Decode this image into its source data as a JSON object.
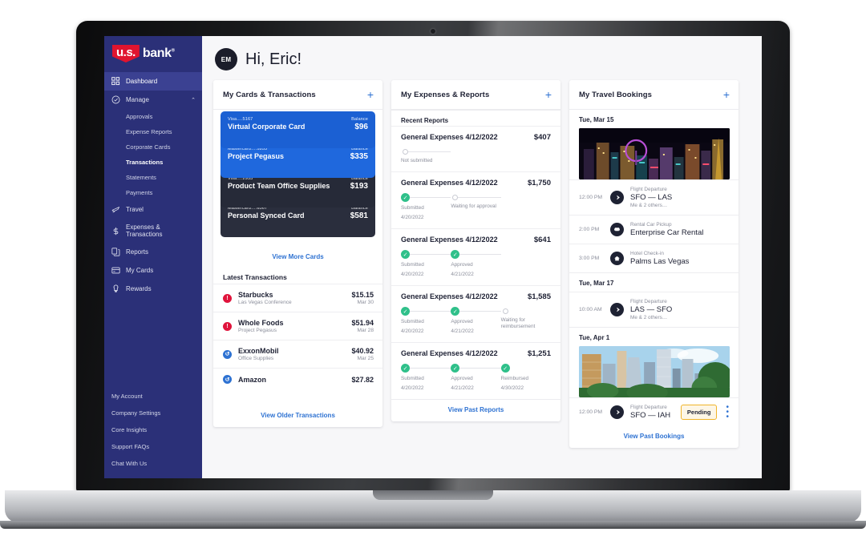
{
  "brand": {
    "logo_shield": "u.s.",
    "logo_word": "bank",
    "primary": "#2b3078",
    "accent": "#2e72d2",
    "red": "#e0142f",
    "green": "#2fc08a"
  },
  "sidebar": {
    "items": [
      {
        "label": "Dashboard",
        "icon": "dashboard-grid-icon",
        "active": true
      },
      {
        "label": "Manage",
        "icon": "check-circle-icon",
        "active": false,
        "expanded": true,
        "chevron": "⌃"
      },
      {
        "label": "Travel",
        "icon": "plane-icon",
        "active": false
      },
      {
        "label": "Expenses & Transactions",
        "icon": "dollar-icon",
        "active": false
      },
      {
        "label": "Reports",
        "icon": "documents-icon",
        "active": false
      },
      {
        "label": "My Cards",
        "icon": "credit-card-icon",
        "active": false
      },
      {
        "label": "Rewards",
        "icon": "award-icon",
        "active": false
      }
    ],
    "sub_items": [
      {
        "label": "Approvals",
        "active": false
      },
      {
        "label": "Expense Reports",
        "active": false
      },
      {
        "label": "Corporate Cards",
        "active": false
      },
      {
        "label": "Transactions",
        "active": true
      },
      {
        "label": "Statements",
        "active": false
      },
      {
        "label": "Payments",
        "active": false
      }
    ],
    "footer_items": [
      {
        "label": "My Account"
      },
      {
        "label": "Company Settings"
      },
      {
        "label": "Core Insights"
      },
      {
        "label": "Support FAQs"
      },
      {
        "label": "Chat With Us"
      }
    ]
  },
  "header": {
    "avatar_initials": "EM",
    "greeting": "Hi, Eric!"
  },
  "cards_panel": {
    "title": "My Cards & Transactions",
    "add_icon": "plus-icon",
    "cards": [
      {
        "issuer": "Visa….5167",
        "name": "Virtual Corporate Card",
        "balance_label": "Balance",
        "balance": "$96"
      },
      {
        "issuer": "Mastercard….1853",
        "name": "Project Pegasus",
        "balance_label": "Balance",
        "balance": "$335"
      },
      {
        "issuer": "Visa….2955",
        "name": "Product Team Office Supplies",
        "balance_label": "Balance",
        "balance": "$193"
      },
      {
        "issuer": "Mastercard….6567",
        "name": "Personal Synced Card",
        "balance_label": "Balance",
        "balance": "$581"
      }
    ],
    "view_more": "View More Cards",
    "transactions_title": "Latest Transactions",
    "transactions": [
      {
        "icon": "alert-icon",
        "merchant": "Starbucks",
        "detail": "Las Vegas Conference",
        "amount": "$15.15",
        "date": "Mar 30"
      },
      {
        "icon": "alert-icon",
        "merchant": "Whole Foods",
        "detail": "Project Pegasus",
        "amount": "$51.94",
        "date": "Mar 28"
      },
      {
        "icon": "sync-icon",
        "merchant": "ExxonMobil",
        "detail": "Office Supplies",
        "amount": "$40.92",
        "date": "Mar 25"
      },
      {
        "icon": "sync-icon",
        "merchant": "Amazon",
        "detail": "",
        "amount": "$27.82",
        "date": ""
      }
    ],
    "view_older": "View Older Transactions"
  },
  "reports_panel": {
    "title": "My Expenses & Reports",
    "add_icon": "plus-icon",
    "recent_title": "Recent Reports",
    "reports": [
      {
        "name": "General Expenses 4/12/2022",
        "amount": "$407",
        "steps": [
          {
            "label": "Not submitted",
            "date": "",
            "done": false
          }
        ]
      },
      {
        "name": "General Expenses 4/12/2022",
        "amount": "$1,750",
        "steps": [
          {
            "label": "Submitted",
            "date": "4/20/2022",
            "done": true
          },
          {
            "label": "Waiting for approval",
            "date": "",
            "done": false
          }
        ]
      },
      {
        "name": "General Expenses 4/12/2022",
        "amount": "$641",
        "steps": [
          {
            "label": "Submitted",
            "date": "4/20/2022",
            "done": true
          },
          {
            "label": "Approved",
            "date": "4/21/2022",
            "done": true
          }
        ]
      },
      {
        "name": "General Expenses 4/12/2022",
        "amount": "$1,585",
        "steps": [
          {
            "label": "Submitted",
            "date": "4/20/2022",
            "done": true
          },
          {
            "label": "Approved",
            "date": "4/21/2022",
            "done": true
          },
          {
            "label": "Waiting for reimbursement",
            "date": "",
            "done": false
          }
        ]
      },
      {
        "name": "General Expenses 4/12/2022",
        "amount": "$1,251",
        "steps": [
          {
            "label": "Submitted",
            "date": "4/20/2022",
            "done": true
          },
          {
            "label": "Approved",
            "date": "4/21/2022",
            "done": true
          },
          {
            "label": "Reimbursed",
            "date": "4/30/2022",
            "done": true
          }
        ]
      }
    ],
    "view_past": "View Past Reports"
  },
  "travel_panel": {
    "title": "My Travel Bookings",
    "add_icon": "plus-icon",
    "days": [
      {
        "date": "Tue, Mar 15",
        "photo": "las-vegas-strip-night"
      },
      {
        "date": "Tue, Mar 17",
        "photo": ""
      },
      {
        "date": "Tue, Apr 1",
        "photo": "houston-skyline-day"
      }
    ],
    "bookings_day1": [
      {
        "time": "12:00 PM",
        "icon": "plane-icon",
        "type": "Flight Departure",
        "title": "SFO — LAS",
        "people": "Me & 2 others…"
      },
      {
        "time": "2:00 PM",
        "icon": "car-icon",
        "type": "Rental Car Pickup",
        "title": "Enterprise Car Rental",
        "people": ""
      },
      {
        "time": "3:00 PM",
        "icon": "hotel-icon",
        "type": "Hotel Check-in",
        "title": "Palms Las Vegas",
        "people": ""
      }
    ],
    "bookings_day2": [
      {
        "time": "10:00 AM",
        "icon": "plane-icon",
        "type": "Flight Departure",
        "title": "LAS — SFO",
        "people": "Me & 2 others…"
      }
    ],
    "bookings_day3": [
      {
        "time": "12:00 PM",
        "icon": "plane-icon",
        "type": "Flight Departure",
        "title": "SFO — IAH",
        "people": "",
        "status": "Pending",
        "menu_icon": "kebab-menu-icon"
      }
    ],
    "view_past": "View Past Bookings"
  }
}
